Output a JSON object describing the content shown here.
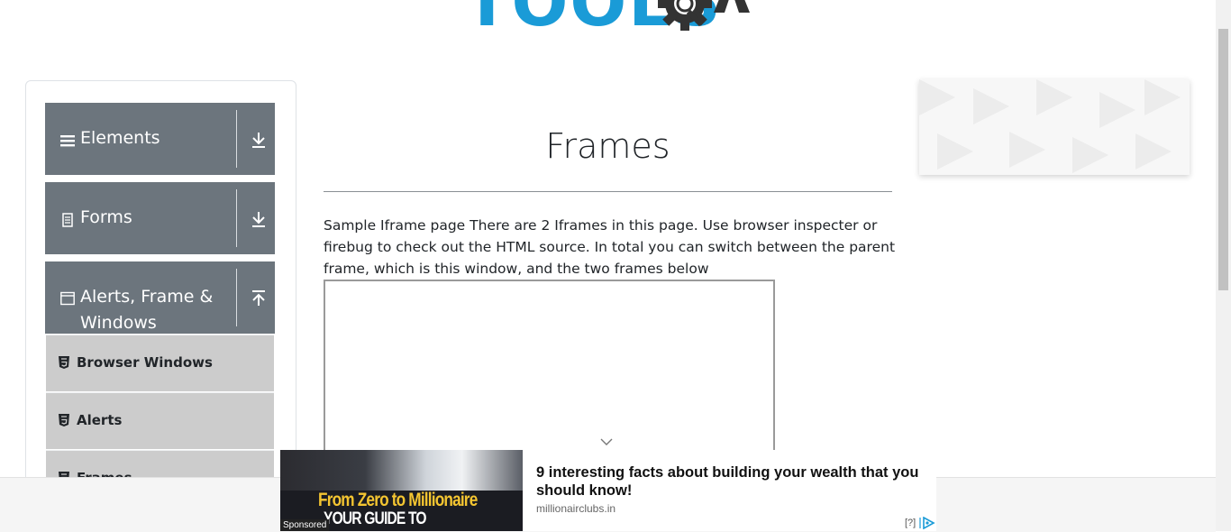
{
  "header": {
    "logo_text": "TOOLS",
    "logo_suffix": "QA"
  },
  "sidebar": {
    "groups": [
      {
        "label": "Elements",
        "icon": "hamburger-icon",
        "arrow": "download-arrow-icon"
      },
      {
        "label": "Forms",
        "icon": "document-icon",
        "arrow": "download-arrow-icon"
      },
      {
        "label": "Alerts, Frame & Windows",
        "icon": "window-icon",
        "arrow": "upload-arrow-icon"
      }
    ],
    "items": [
      {
        "label": "Browser Windows",
        "icon": "html5-icon"
      },
      {
        "label": "Alerts",
        "icon": "html5-icon"
      },
      {
        "label": "Frames",
        "icon": "html5-icon"
      }
    ]
  },
  "main": {
    "title": "Frames",
    "description": "Sample Iframe page There are 2 Iframes in this page. Use browser inspecter or firebug to check out the HTML source. In total you can switch between the parent frame, which is this window, and the two frames below"
  },
  "ad": {
    "image_line1": "From Zero to Millionaire",
    "image_line2": "YOUR GUIDE TO FINANCIAL SUCCESS!",
    "sponsored": "Sponsored",
    "title": "9 interesting facts about building your wealth that you should know!",
    "domain": "millionairclubs.in",
    "help": "[?]"
  },
  "colors": {
    "accent_blue": "#1a9bd7",
    "sidebar_header": "#6c757d",
    "sidebar_item": "#cccccc"
  }
}
